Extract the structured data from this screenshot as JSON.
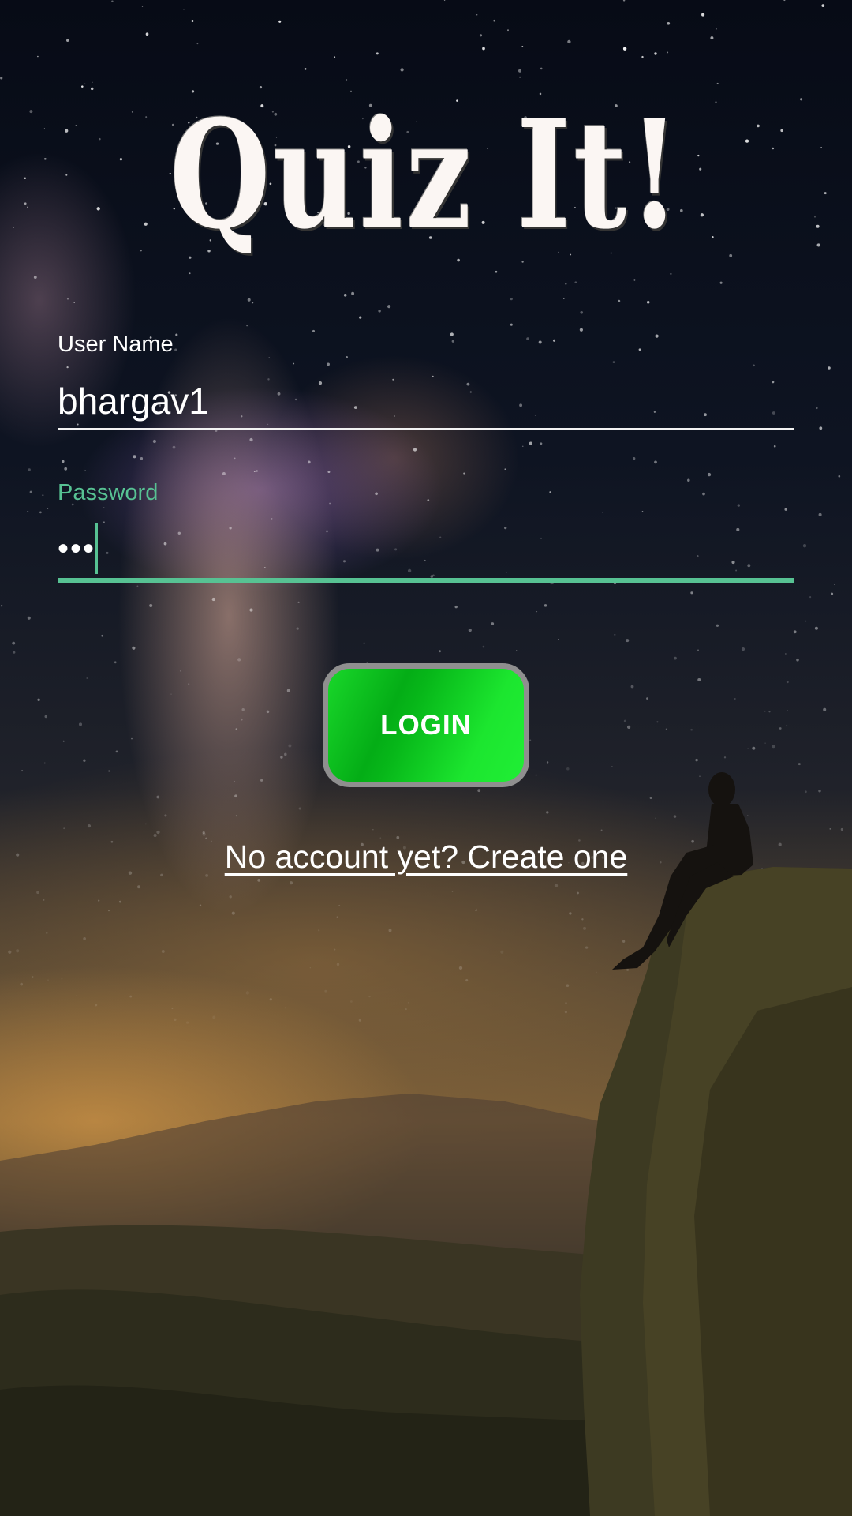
{
  "app": {
    "logo_text": "Quiz It!"
  },
  "form": {
    "username": {
      "label": "User Name",
      "value": "bhargav1"
    },
    "password": {
      "label": "Password",
      "value": "•••"
    }
  },
  "actions": {
    "login_label": "LOGIN",
    "create_account_label": "No account yet? Create one"
  },
  "theme": {
    "accent": "#57c293",
    "button_green": "#10d423",
    "text": "#ffffff"
  }
}
